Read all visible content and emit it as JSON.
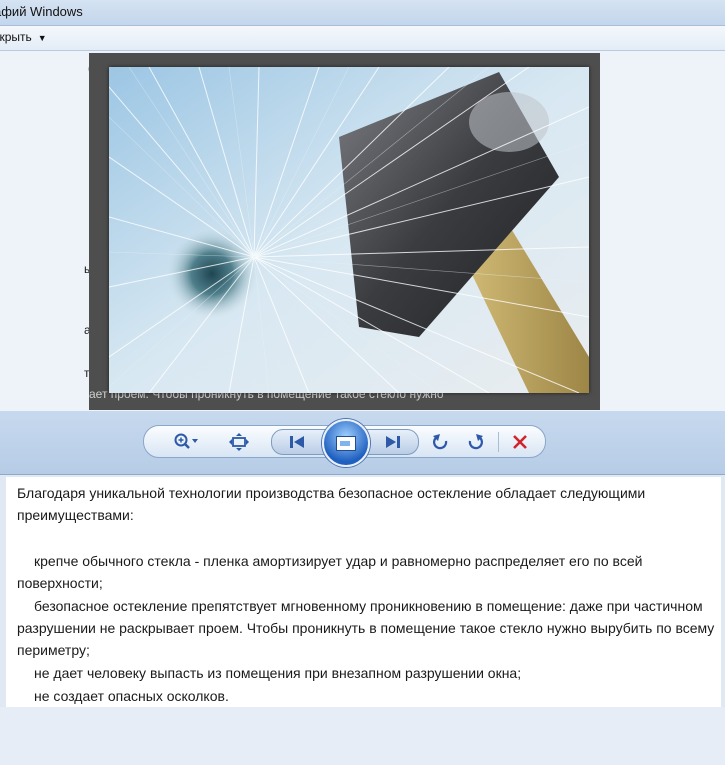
{
  "window": {
    "title": "афий Windows"
  },
  "menubar": {
    "open_label": "ткрыть",
    "open_arrow": "▼"
  },
  "viewer": {
    "photo_alt": "broken glass hammer",
    "behind_text": [
      "б",
      "|",
      "ы пр",
      "а а",
      "тву",
      "ает проем. Чтобы проникнуть в помещение такое стекло нужно"
    ]
  },
  "toolbar": {
    "zoom_icon": "zoom-icon",
    "fit_icon": "actual-size-icon",
    "prev_icon": "previous-icon",
    "slideshow_icon": "slideshow-icon",
    "next_icon": "next-icon",
    "rotate_left_icon": "rotate-ccw-icon",
    "rotate_right_icon": "rotate-cw-icon",
    "delete_icon": "delete-icon",
    "delete_color": "#d1232a",
    "icon_color": "#2d59a8"
  },
  "text": {
    "intro": "Благодаря уникальной технологии производства безопасное остекление обладает следующими преимуществами:",
    "items": [
      "крепче обычного стекла - пленка амортизирует удар и равномерно распределяет его по всей поверхности;",
      "безопасное остекление препятствует мгновенному проникновению в помещение: даже при частичном разрушении не раскрывает проем. Чтобы проникнуть в помещение такое стекло нужно вырубить по всему периметру;",
      "не дает человеку выпасть из помещения при  внезапном разрушении окна;",
      "не создает опасных осколков."
    ]
  }
}
